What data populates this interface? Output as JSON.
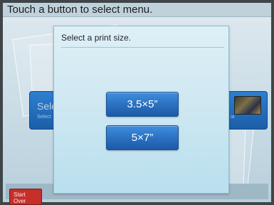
{
  "screen": {
    "title": "Touch a button to select menu."
  },
  "background_menu": {
    "left_button": {
      "title": "Sele",
      "subtitle": "Select"
    },
    "right_button": {
      "subtitle": "ia",
      "thumbnail_icon": "photo-stack-icon"
    }
  },
  "dialog": {
    "title": "Select a print size.",
    "options": [
      {
        "label": "3.5×5”"
      },
      {
        "label": "5×7”"
      }
    ]
  },
  "footer": {
    "start_over_label_line1": "Start",
    "start_over_label_line2": "Over"
  },
  "colors": {
    "accent_blue": "#2a6fbf",
    "start_over_red": "#c62f2a",
    "dialog_bg": "#cfe8f2"
  }
}
